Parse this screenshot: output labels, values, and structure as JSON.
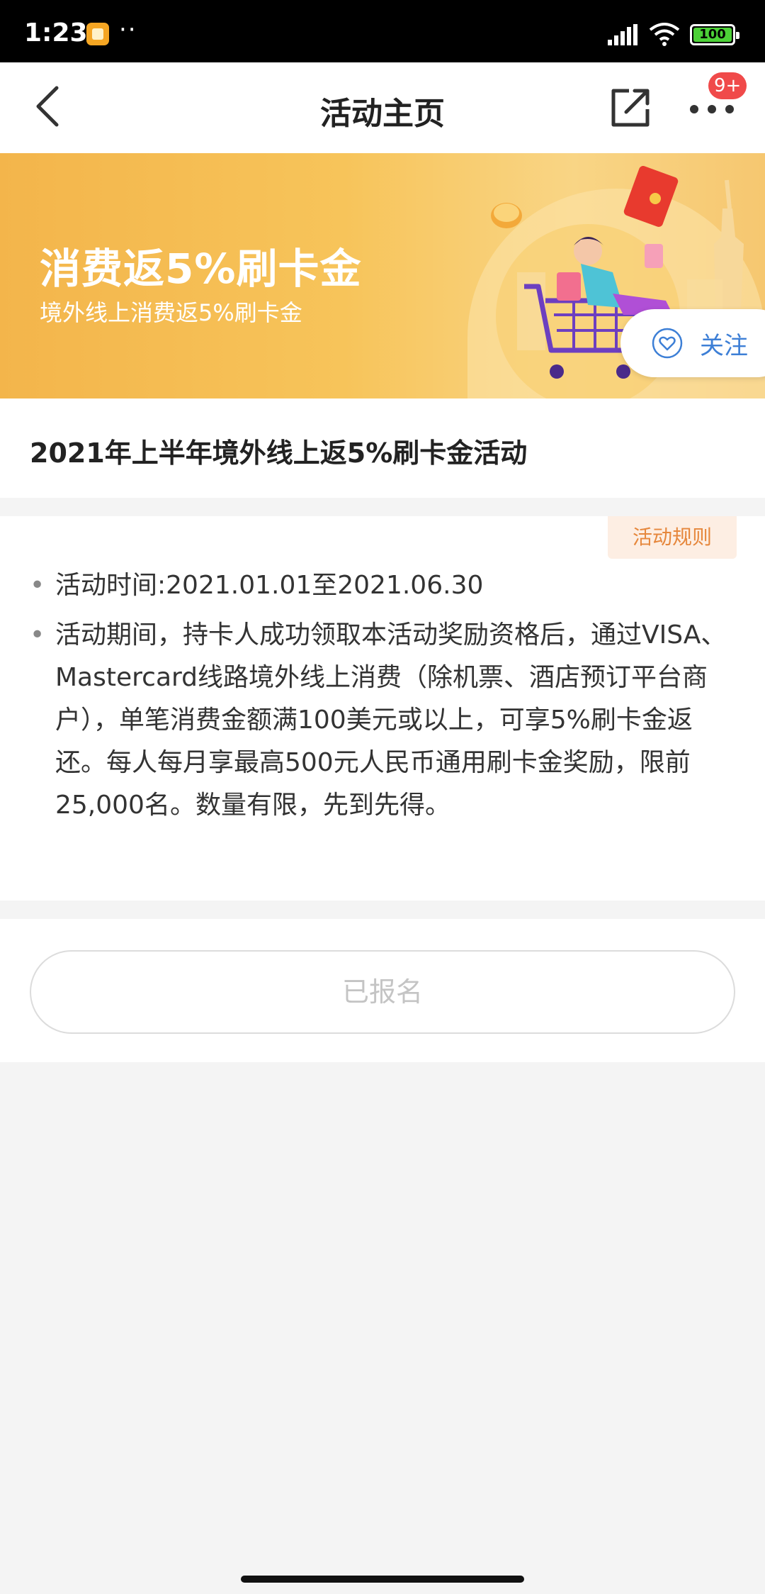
{
  "status_bar": {
    "time": "1:23",
    "dots": "··",
    "battery": "100"
  },
  "nav": {
    "title": "活动主页",
    "badge": "9+"
  },
  "banner": {
    "headline": "消费返5%刷卡金",
    "subline": "境外线上消费返5%刷卡金",
    "follow_label": "关注"
  },
  "activity": {
    "title": "2021年上半年境外线上返5%刷卡金活动",
    "rules_label": "活动规则",
    "items": [
      "活动时间:2021.01.01至2021.06.30",
      "活动期间，持卡人成功领取本活动奖励资格后，通过VISA、Mastercard线路境外线上消费（除机票、酒店预订平台商户），单笔消费金额满100美元或以上，可享5%刷卡金返还。每人每月享最高500元人民币通用刷卡金奖励，限前25,000名。数量有限，先到先得。"
    ]
  },
  "action": {
    "button_label": "已报名"
  },
  "colors": {
    "banner": "#f3b54b",
    "accent": "#e6873c",
    "badge": "#f04a4a",
    "link": "#3d7fd6"
  },
  "icons": [
    "back-icon",
    "share-icon",
    "more-icon",
    "heart-icon",
    "signal-icon",
    "wifi-icon",
    "battery-icon"
  ]
}
